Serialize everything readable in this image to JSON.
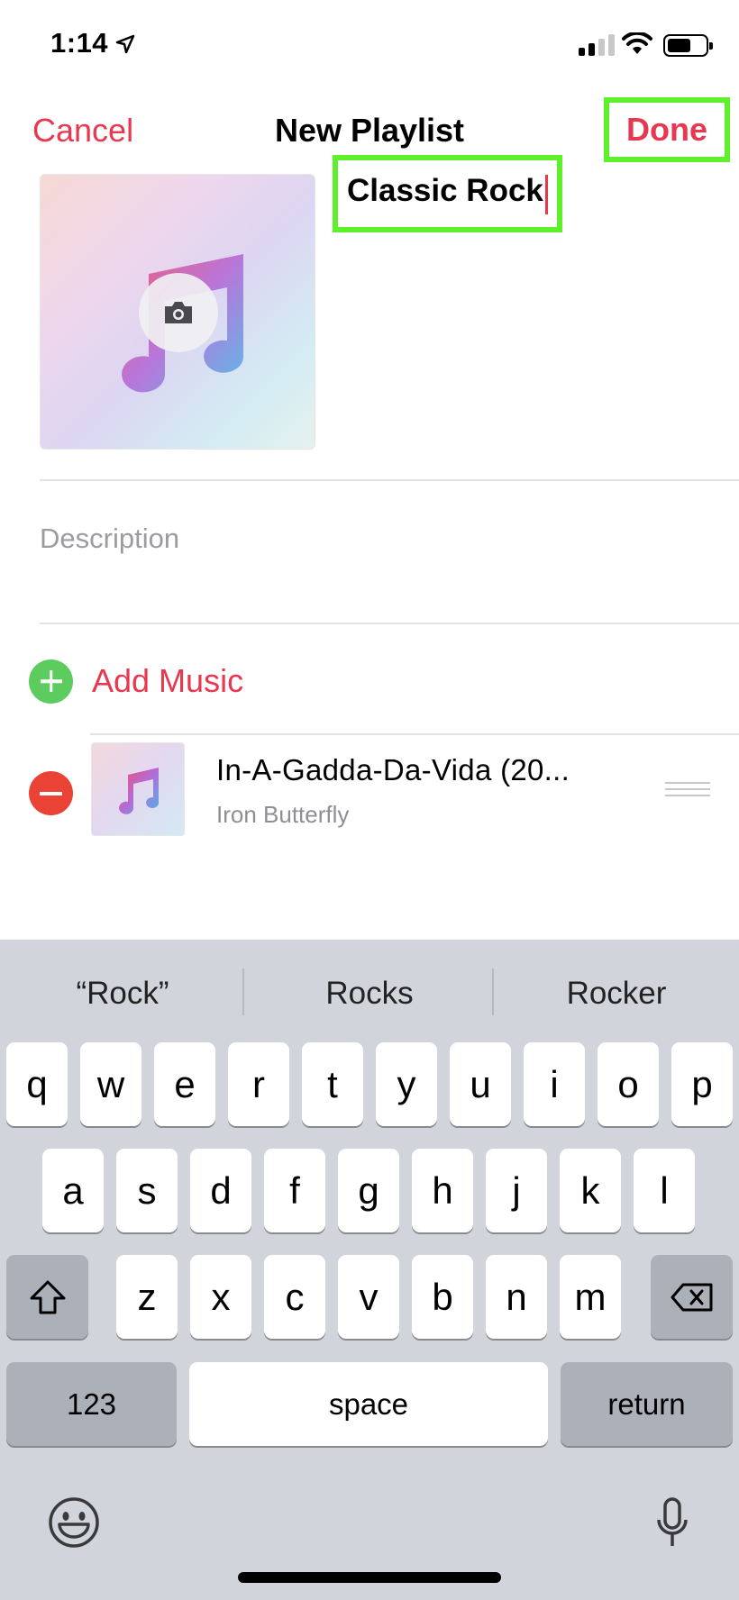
{
  "status_bar": {
    "time": "1:14"
  },
  "nav": {
    "cancel_label": "Cancel",
    "title": "New Playlist",
    "done_label": "Done"
  },
  "playlist": {
    "title_value": "Classic Rock",
    "description_placeholder": "Description"
  },
  "add_music_label": "Add Music",
  "songs": [
    {
      "title": "In-A-Gadda-Da-Vida (20...",
      "artist": "Iron Butterfly"
    }
  ],
  "keyboard": {
    "suggestions": [
      "“Rock”",
      "Rocks",
      "Rocker"
    ],
    "rows": [
      [
        "q",
        "w",
        "e",
        "r",
        "t",
        "y",
        "u",
        "i",
        "o",
        "p"
      ],
      [
        "a",
        "s",
        "d",
        "f",
        "g",
        "h",
        "j",
        "k",
        "l"
      ],
      [
        "z",
        "x",
        "c",
        "v",
        "b",
        "n",
        "m"
      ]
    ],
    "numbers_label": "123",
    "space_label": "space",
    "return_label": "return"
  },
  "colors": {
    "accent": "#e8384f",
    "highlight": "#5ef02a",
    "add_green": "#5dcc5e",
    "remove_red": "#ea4335",
    "keyboard_bg": "#d1d4da"
  },
  "icons": [
    "location-arrow-icon",
    "cellular-signal-icon",
    "wifi-icon",
    "battery-icon",
    "music-note-icon",
    "camera-icon",
    "add-icon",
    "remove-icon",
    "reorder-handle-icon",
    "shift-icon",
    "delete-icon",
    "emoji-icon",
    "microphone-icon"
  ]
}
